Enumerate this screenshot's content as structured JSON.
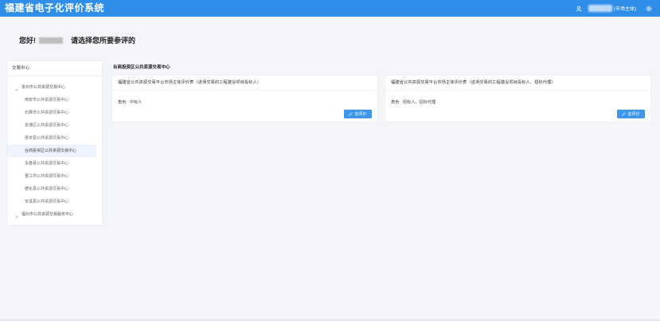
{
  "header": {
    "title": "福建省电子化评价系统",
    "user_role": "(市场主体)",
    "icons": {
      "user": "user-icon",
      "settings": "settings-icon"
    }
  },
  "greeting": {
    "hello": "您好!",
    "prompt": "请选择您所要参评的"
  },
  "sidebar": {
    "header": "交易中心",
    "groups": [
      {
        "label": "泉州市公共资源交易中心",
        "expanded": true,
        "children": [
          {
            "label": "南安市公共资源交易中心",
            "active": false
          },
          {
            "label": "石狮市公共资源交易中心",
            "active": false
          },
          {
            "label": "泉港区公共资源交易中心",
            "active": false
          },
          {
            "label": "惠安县公共资源交易中心",
            "active": false
          },
          {
            "label": "台商投资区公共资源交易中心",
            "active": true
          },
          {
            "label": "永春县公共资源交易中心",
            "active": false
          },
          {
            "label": "晋江市公共资源交易中心",
            "active": false
          },
          {
            "label": "德化县公共资源交易中心",
            "active": false
          },
          {
            "label": "安溪县公共资源交易中心",
            "active": false
          }
        ]
      },
      {
        "label": "福州市公共资源交易服务中心",
        "expanded": false,
        "children": []
      }
    ]
  },
  "main": {
    "section_title": "台商投资区公共资源交易中心",
    "cards": [
      {
        "title": "福建省公共资源交易平台市场主体评价表（进场交易的工程建设项目投标人）",
        "role_label": "角色:",
        "role_value": "中标人",
        "button_label": "去评价"
      },
      {
        "title": "福建省公共资源交易平台市场主体评价表（进场交易的工程建设项目投标人、招标代理）",
        "role_label": "角色:",
        "role_value": "招标人、招标代理",
        "button_label": "去评价"
      }
    ]
  },
  "colors": {
    "primary": "#2f8ee8",
    "button": "#3e97ea",
    "background": "#f3f5f9",
    "active_item": "#eef4fd"
  }
}
